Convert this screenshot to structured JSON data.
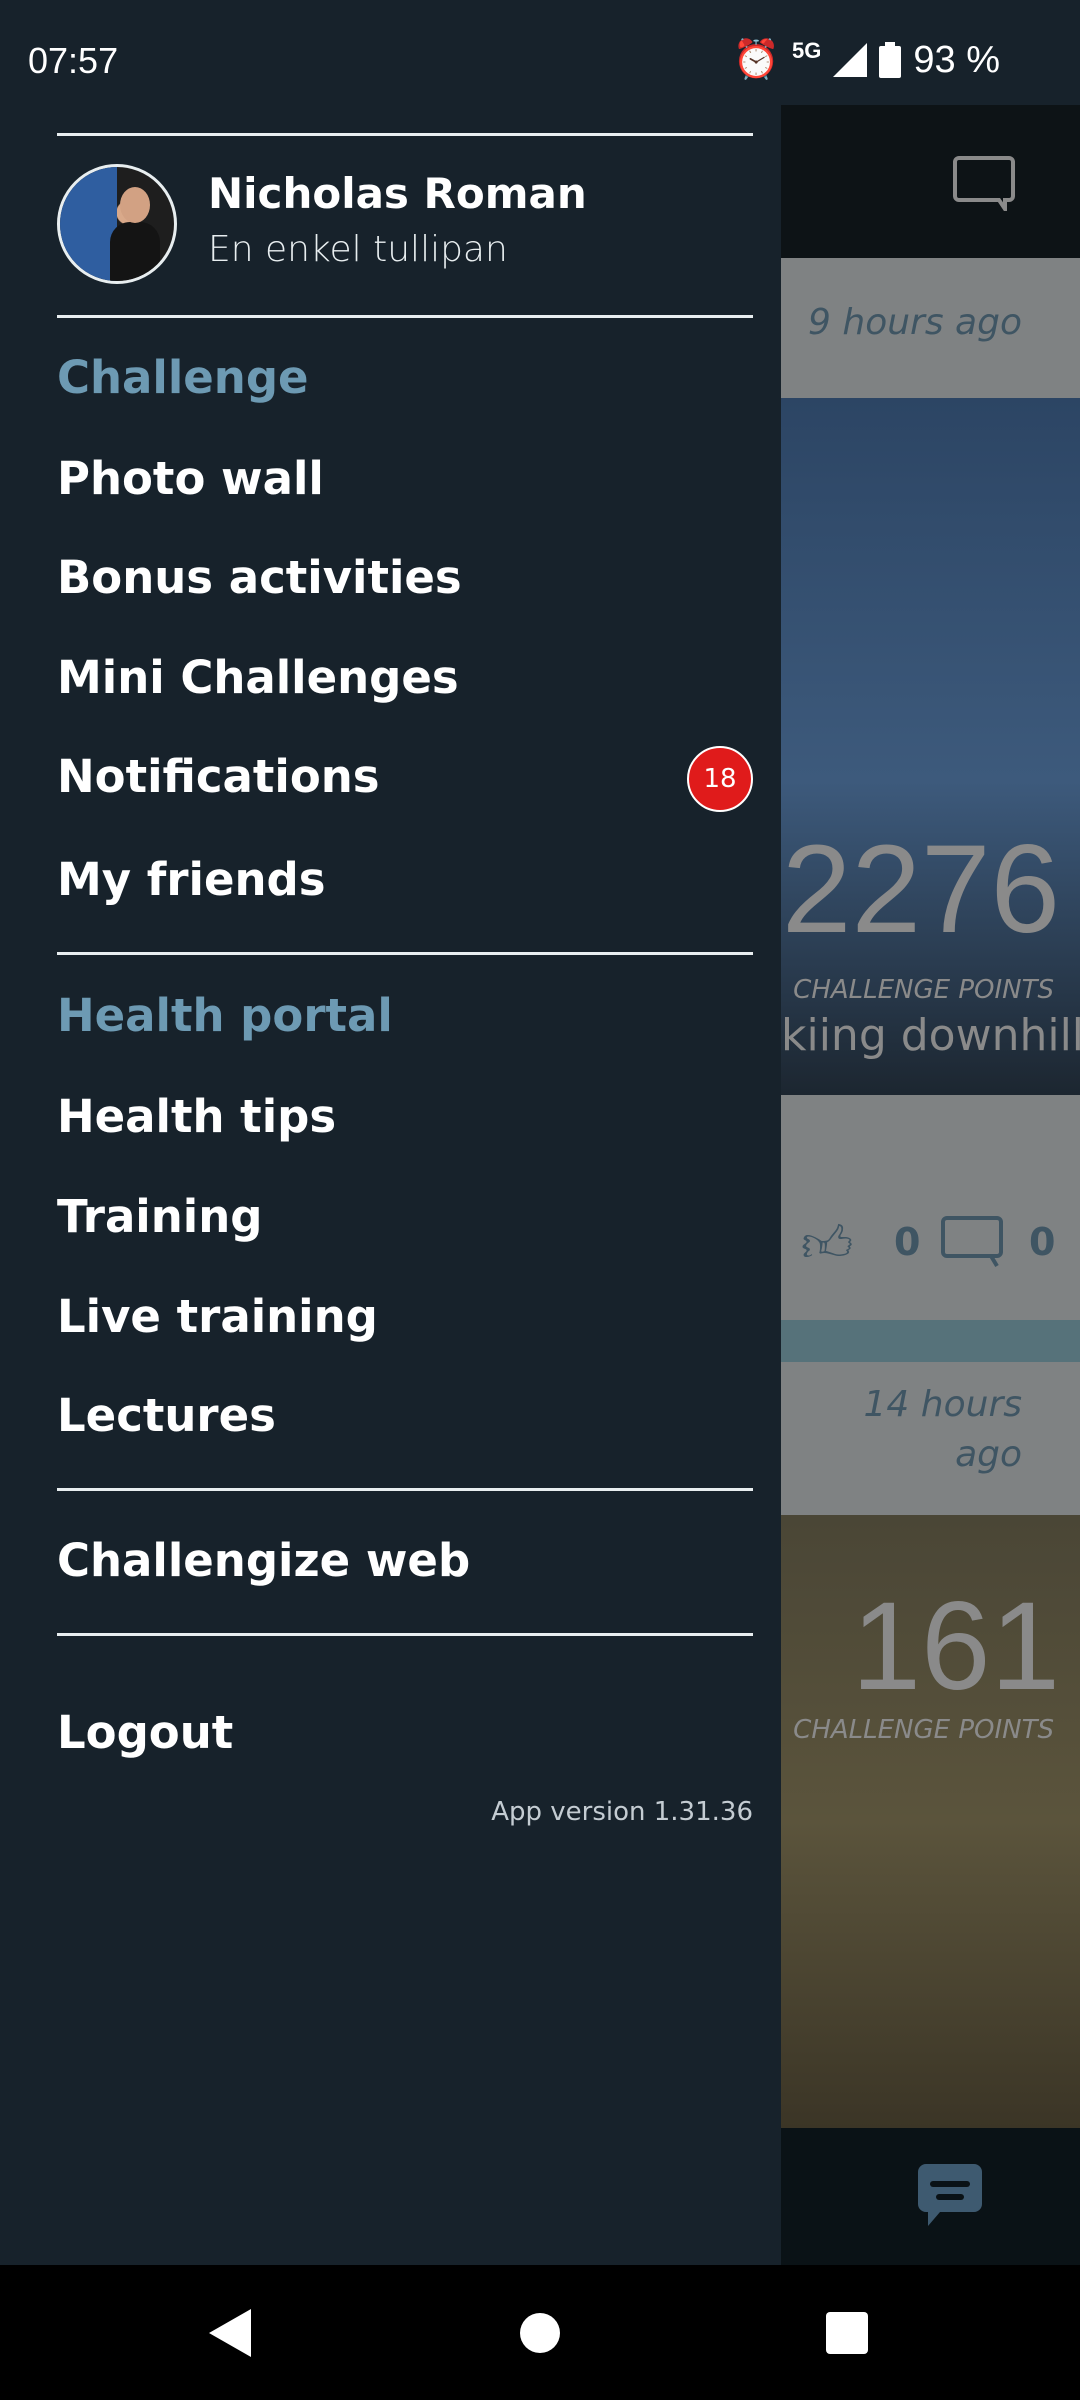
{
  "status_bar": {
    "time": "07:57",
    "network": "5G",
    "battery": "93 %"
  },
  "drawer": {
    "profile": {
      "name": "Nicholas Roman",
      "subtitle": "En enkel tullipan"
    },
    "sections": [
      {
        "title": "Challenge",
        "items": [
          "Photo wall",
          "Bonus activities",
          "Mini Challenges",
          "Notifications",
          "My friends"
        ]
      },
      {
        "title": "Health portal",
        "items": [
          "Health tips",
          "Training",
          "Live training",
          "Lectures"
        ]
      }
    ],
    "notifications_badge": "18",
    "web_link": "Challengize web",
    "logout": "Logout",
    "app_version": "App version 1.31.36"
  },
  "feed": {
    "posts": [
      {
        "time": "9 hours ago",
        "points": "2276",
        "points_label": "CHALLENGE POINTS",
        "activity": "kiing downhill",
        "likes": "0",
        "comments": "0"
      },
      {
        "time": "14 hours ago",
        "points": "161",
        "points_label": "CHALLENGE POINTS"
      }
    ]
  },
  "colors": {
    "drawer_bg": "#17222b",
    "section": "#6d9ab3",
    "badge": "#e01b1b"
  }
}
